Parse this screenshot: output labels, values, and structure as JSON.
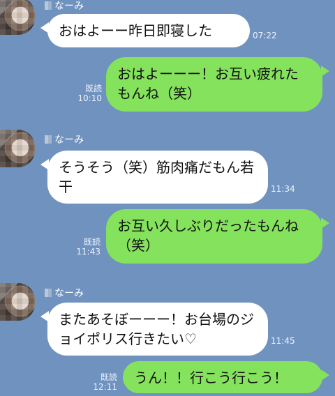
{
  "theme": {
    "background": "#7092BE",
    "incoming_bubble": "#FFFFFF",
    "outgoing_bubble": "#84E25C"
  },
  "chat": {
    "messages": [
      {
        "sender_name": "なーみ",
        "text": "おはよーー昨日即寝した",
        "time": "07:22"
      },
      {
        "read_label": "既読",
        "text": "おはよーーー！お互い疲れたもんね（笑）",
        "time": "10:10"
      },
      {
        "sender_name": "なーみ",
        "text": "そうそう（笑）筋肉痛だもん若干",
        "time": "11:34"
      },
      {
        "read_label": "既読",
        "text": "お互い久しぶりだったもんね（笑）",
        "time": "11:43"
      },
      {
        "sender_name": "なーみ",
        "text": "またあそぼーーー！お台場のジョイポリス行きたい♡",
        "time": "11:45"
      },
      {
        "read_label": "既読",
        "text": "うん！！行こう行こう！",
        "time": "12:11"
      }
    ]
  }
}
